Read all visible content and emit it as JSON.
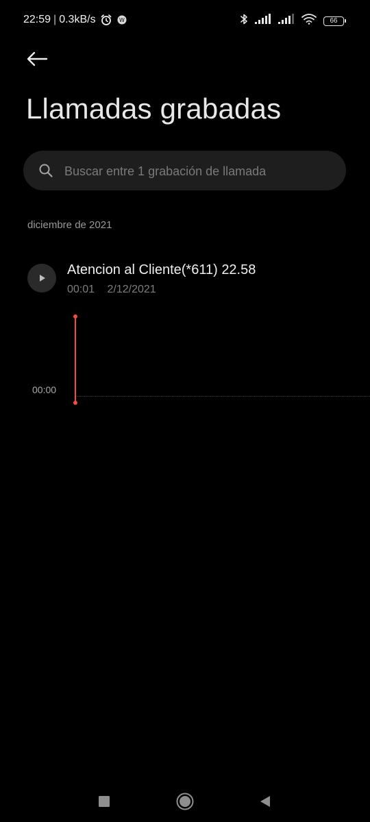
{
  "status_bar": {
    "time": "22:59",
    "separator": "|",
    "network_speed": "0.3kB/s",
    "battery_level": "66",
    "icons": [
      "alarm-icon",
      "notification-icon",
      "bluetooth-icon",
      "signal-icon",
      "signal-icon",
      "wifi-icon",
      "battery-icon"
    ]
  },
  "header": {
    "back_icon": "arrow-left-icon",
    "title": "Llamadas grabadas"
  },
  "search": {
    "placeholder": "Buscar entre 1 grabación de llamada",
    "value": "",
    "icon": "search-icon"
  },
  "recordings": {
    "section_label": "diciembre de 2021",
    "items": [
      {
        "title": "Atencion al Cliente(*611) 22.58",
        "duration": "00:01",
        "date": "2/12/2021",
        "icon": "play-icon"
      }
    ]
  },
  "player": {
    "current_time": "00:00",
    "progress": 0,
    "playhead_color": "#f24c3d"
  },
  "nav_bar": {
    "icons": [
      "recents-icon",
      "home-icon",
      "back-icon"
    ]
  },
  "colors": {
    "background": "#000000",
    "search_background": "#1e1e1e",
    "accent": "#f24c3d"
  }
}
